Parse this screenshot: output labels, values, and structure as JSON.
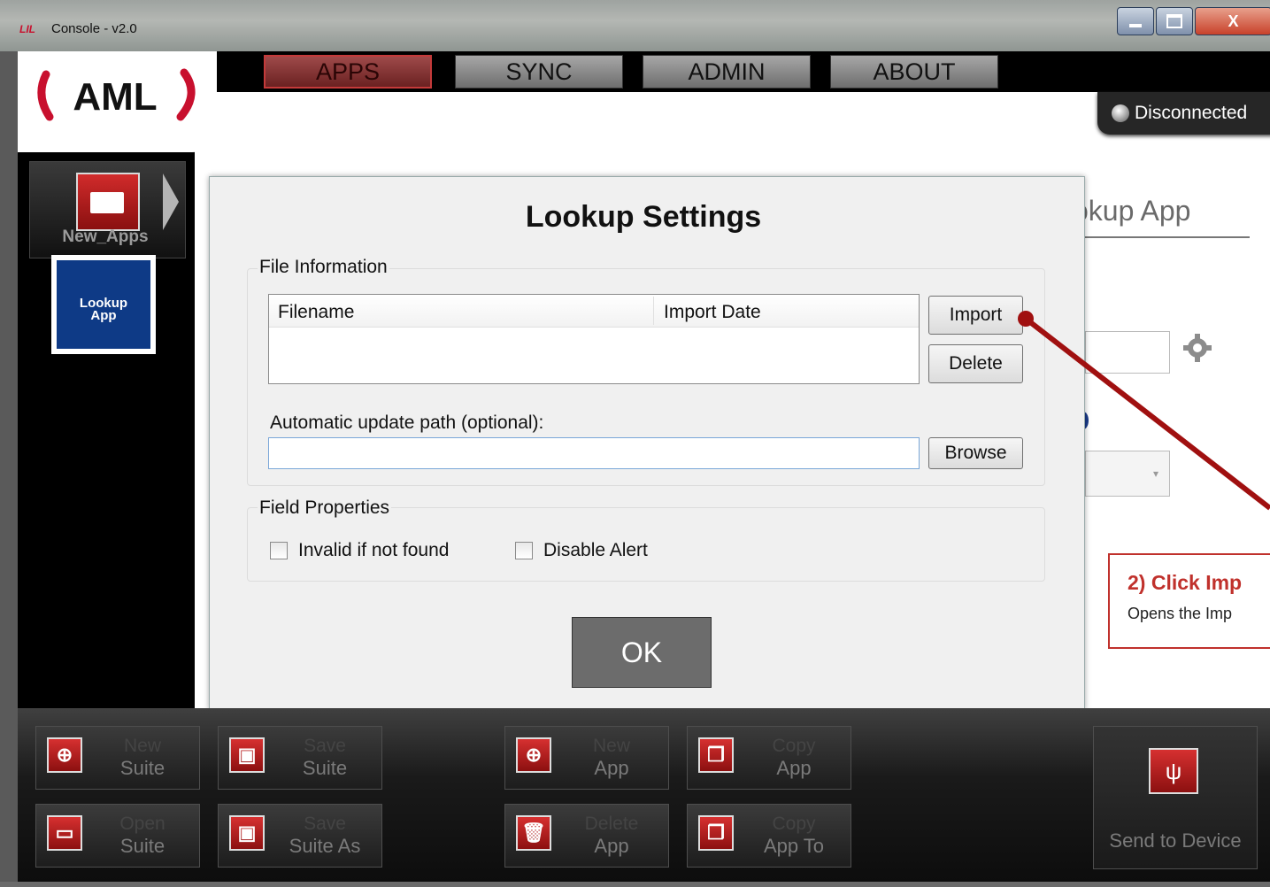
{
  "window": {
    "title": "Console - v2.0",
    "mini_logo": "LIL",
    "close_glyph": "X"
  },
  "tabs": [
    {
      "label": "APPS",
      "active": true
    },
    {
      "label": "SYNC",
      "active": false
    },
    {
      "label": "ADMIN",
      "active": false
    },
    {
      "label": "ABOUT",
      "active": false
    }
  ],
  "logo": {
    "text": "AML"
  },
  "status": {
    "label": "Disconnected",
    "icon": "status-led-icon"
  },
  "sidebar": {
    "folder_label": "New_Apps",
    "app_tile": {
      "line1": "Lookup",
      "line2": "App"
    }
  },
  "background_panel": {
    "title": "okup App"
  },
  "dialog": {
    "title": "Lookup Settings",
    "file_info": {
      "label": "File Information",
      "columns": [
        "Filename",
        "Import Date"
      ],
      "rows": [],
      "import_label": "Import",
      "delete_label": "Delete",
      "path_label": "Automatic update path (optional):",
      "path_value": "",
      "browse_label": "Browse"
    },
    "field_props": {
      "label": "Field Properties",
      "invalid_label": "Invalid if not found",
      "invalid_checked": false,
      "alert_label": "Disable Alert",
      "alert_checked": false
    },
    "ok_label": "OK"
  },
  "callout": {
    "title": "2) Click Imp",
    "subtitle": "Opens the Imp"
  },
  "toolbar": {
    "new_suite": {
      "l1": "New",
      "l2": "Suite",
      "icon": "plus-icon"
    },
    "save_suite": {
      "l1": "Save",
      "l2": "Suite",
      "icon": "save-icon"
    },
    "open_suite": {
      "l1": "Open",
      "l2": "Suite",
      "icon": "open-folder-icon"
    },
    "save_suite_as": {
      "l1": "Save",
      "l2": "Suite As",
      "icon": "save-as-icon"
    },
    "new_app": {
      "l1": "New",
      "l2": "App",
      "icon": "plus-icon"
    },
    "copy_app": {
      "l1": "Copy",
      "l2": "App",
      "icon": "copy-icon"
    },
    "delete_app": {
      "l1": "Delete",
      "l2": "App",
      "icon": "trash-icon"
    },
    "copy_app_to": {
      "l1": "Copy",
      "l2": "App To",
      "icon": "copy-to-icon"
    },
    "send": {
      "label": "Send to Device",
      "icon": "usb-icon"
    }
  },
  "colors": {
    "accent_red": "#c0312c",
    "brand_blue": "#0e3a86",
    "toolbar_dark": "#1a1a1a"
  }
}
